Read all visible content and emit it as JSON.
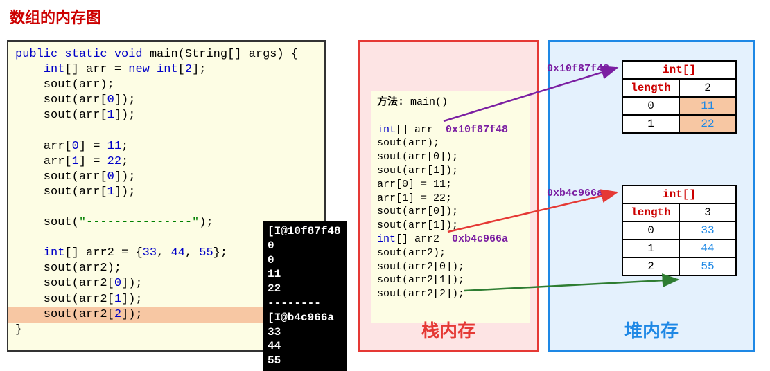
{
  "title": "数组的内存图",
  "code": {
    "line1": "public static void main(String[] args) {",
    "line2_pre": "    ",
    "line2_type": "int",
    "line2_mid": "[] arr = ",
    "line2_new": "new int",
    "line2_open": "[",
    "line2_n": "2",
    "line2_end": "];",
    "line3": "    sout(arr);",
    "line4_pre": "    sout(arr[",
    "line4_i": "0",
    "line4_end": "]);",
    "line5_pre": "    sout(arr[",
    "line5_i": "1",
    "line5_end": "]);",
    "line_blank": "",
    "line6_pre": "    arr[",
    "line6_i": "0",
    "line6_mid": "] = ",
    "line6_v": "11",
    "line6_end": ";",
    "line7_pre": "    arr[",
    "line7_i": "1",
    "line7_mid": "] = ",
    "line7_v": "22",
    "line7_end": ";",
    "line8_pre": "    sout(arr[",
    "line8_i": "0",
    "line8_end": "]);",
    "line9_pre": "    sout(arr[",
    "line9_i": "1",
    "line9_end": "]);",
    "line10_pre": "    sout(",
    "line10_str": "\"---------------\"",
    "line10_end": ");",
    "line11_pre": "    ",
    "line11_type": "int",
    "line11_mid": "[] arr2 = {",
    "line11_a": "33",
    "line11_c1": ", ",
    "line11_b": "44",
    "line11_c2": ", ",
    "line11_c": "55",
    "line11_end": "};",
    "line12": "    sout(arr2);",
    "line13_pre": "    sout(arr2[",
    "line13_i": "0",
    "line13_end": "]);",
    "line14_pre": "    sout(arr2[",
    "line14_i": "1",
    "line14_end": "]);",
    "line15_pre": "    sout(arr2[",
    "line15_i": "2",
    "line15_end": "]);",
    "line16": "}"
  },
  "console": {
    "l1": "[I@10f87f48",
    "l2": "0",
    "l3": "0",
    "l4": "11",
    "l5": "22",
    "l6": "--------",
    "l7": "[I@b4c966a",
    "l8": "33",
    "l9": "44",
    "l10": "55"
  },
  "stack": {
    "label": "栈内存",
    "method_label": "方法:",
    "method_name": " main()",
    "s1_pre": "int[] arr ",
    "s1_addr": "0x10f87f48",
    "s2": "sout(arr);",
    "s3": "sout(arr[0]);",
    "s4": "sout(arr[1]);",
    "s5": "arr[0] = 11;",
    "s6": "arr[1] = 22;",
    "s7": "sout(arr[0]);",
    "s8": "sout(arr[1]);",
    "s9_pre": "int[] arr2 ",
    "s9_addr": "0xb4c966a",
    "s10": "sout(arr2);",
    "s11": "sout(arr2[0]);",
    "s12": "sout(arr2[1]);",
    "s13": "sout(arr2[2]);"
  },
  "heap": {
    "label": "堆内存",
    "addr1": "0x10f87f48",
    "addr2": "0xb4c966a",
    "arr1": {
      "type": "int[]",
      "length_label": "length",
      "length": "2",
      "rows": [
        {
          "idx": "0",
          "val": "11"
        },
        {
          "idx": "1",
          "val": "22"
        }
      ]
    },
    "arr2": {
      "type": "int[]",
      "length_label": "length",
      "length": "3",
      "rows": [
        {
          "idx": "0",
          "val": "33"
        },
        {
          "idx": "1",
          "val": "44"
        },
        {
          "idx": "2",
          "val": "55"
        }
      ]
    }
  }
}
